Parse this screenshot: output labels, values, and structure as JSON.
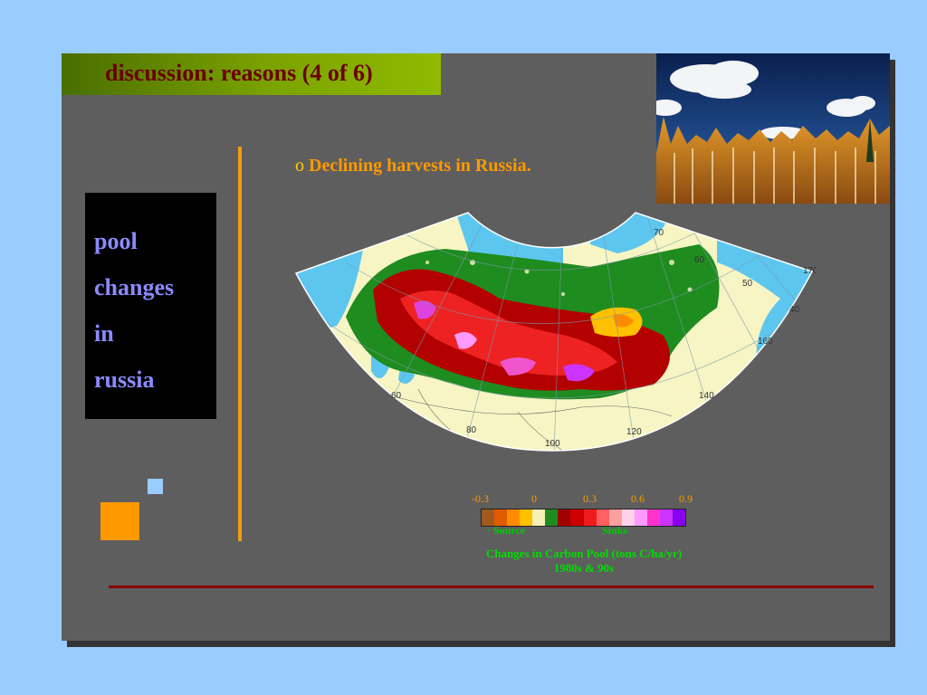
{
  "slide": {
    "title": "discussion: reasons (4 of 6)",
    "side_words": [
      "pool",
      "changes",
      "in",
      "russia"
    ],
    "bullet_mark": "o",
    "bullet_text": "Declining harvests in Russia."
  },
  "map": {
    "lon_labels": [
      "60",
      "80",
      "100",
      "120",
      "140",
      "160",
      "50",
      "40",
      "60",
      "70",
      "170"
    ],
    "lat_labels": [
      "60",
      "50",
      "40"
    ]
  },
  "legend": {
    "ticks": [
      "-0.3",
      "0",
      "0.3",
      "0.6",
      "0.9"
    ],
    "source_label": "· Source",
    "sinks_label": "Sinks",
    "caption_line1": "Changes in Carbon Pool (tons C/ha/yr)",
    "caption_line2": "1980s & 90s",
    "colors": [
      "#a05a1e",
      "#e05a00",
      "#ff8c00",
      "#ffc000",
      "#f6f0b4",
      "#1f8c1f",
      "#a00000",
      "#cc0000",
      "#ee1c1c",
      "#ff6060",
      "#ffa0a0",
      "#ffd0e8",
      "#ff99ff",
      "#ff33cc",
      "#cc33ff",
      "#8800ee"
    ]
  },
  "colors": {
    "background": "#99ccff",
    "slide": "#5e5e5e",
    "title_text": "#6b0000",
    "accent_orange": "#ff9900",
    "rule": "#8b0000"
  }
}
